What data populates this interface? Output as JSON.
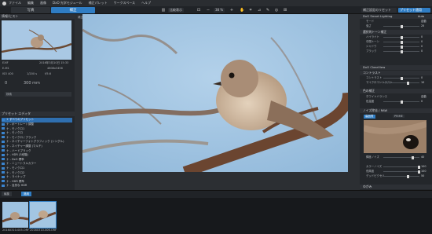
{
  "menubar": {
    "items": [
      "ファイル",
      "編集",
      "画像",
      "DxO 光学モジュール",
      "補正パレット",
      "ワークスペース",
      "ヘルプ"
    ]
  },
  "toolbar": {
    "tab_library": "写真",
    "tab_customize": "補正",
    "compare_label": "比較表示",
    "zoom_label": "38 %",
    "reset_label": "補正設定のリセット",
    "preset_label": "プリセット適用"
  },
  "left": {
    "histogram_header": "情報/ヒスト",
    "info": {
      "format": "EXIF",
      "date": "2016年3月10日 15:33",
      "camera": "E-M1",
      "size": "4608x3456",
      "iso": "ISO 400",
      "shutter": "1/200 s",
      "aperture": "f/5.6",
      "ev": "0",
      "focal": "300 mm"
    },
    "search_label": "検索",
    "preset_header": "プリセット エディタ",
    "tree": [
      "+ すべてのプリセット",
      "ナ - ポートレート調整",
      "ナ - モノクロ1",
      "ナ - モノクロ",
      "ナ - モノクロ / ブラック",
      "ナ - ネイチャーフォトグラフィック (シングル)",
      "ナ - ネイチャー調整 (マルチ)",
      "ナ - ハードブラック",
      "ナ - HDR (3段階)",
      "ナ - DxO 標準",
      "ナ - ニュートラルカラー",
      "ナ - モノクロ1",
      "ナ - モノクロ2",
      "ナ - ライナップ",
      "ナ - HDR 標準",
      "ナ - 自然な HDR",
      "ナ - 強 HDR"
    ],
    "bottom_tab_edit": "編集",
    "bottom_tab_apply": "適用"
  },
  "center": {
    "overlay_label": "補正プレビュー"
  },
  "bottombar": {
    "path": "一枚のみ処理中 / 20160310-006.ORF",
    "page": "画像: 1 / 2",
    "print_label": "プリント",
    "export_label": "ハードディスクにエクスポート"
  },
  "filmstrip": {
    "files": [
      "20160310-005.ORF",
      "20160310-006.ORF"
    ]
  },
  "right": {
    "sections": {
      "smart_lighting": "DxO Smart Lighting",
      "smart_mode": "Auto",
      "tone": "選択的トーン補正",
      "clearview": "DxO ClearView",
      "contrast": "コントラスト",
      "contrast_sub": "コントラスト",
      "microcontrast": "マイクロコントラスト",
      "color": "色の補正",
      "wb": "ホワイトバランス",
      "noise": "ノイズ除去 / RAW",
      "noise_tabs": [
        "高品質",
        "PRIME"
      ],
      "luminance": "輝度ノイズ",
      "color_noise": "カラーノイズ",
      "lowfreq": "低周波",
      "dead_pixels": "デッドピクセル",
      "lens": "ゆがみ",
      "crop": "クロップ"
    },
    "rows": {
      "mode": "モード",
      "intensity": "強さ",
      "highlight": "ハイライト",
      "midtone": "中間トーン",
      "shadow": "シャドウ",
      "black": "ブラック",
      "temp": "色温度",
      "tint": "色合い",
      "auto": "自動",
      "value_100": "100",
      "value_40": "40",
      "value_0": "0",
      "value_25": "25",
      "value_50": "50",
      "value_10": "10"
    }
  }
}
